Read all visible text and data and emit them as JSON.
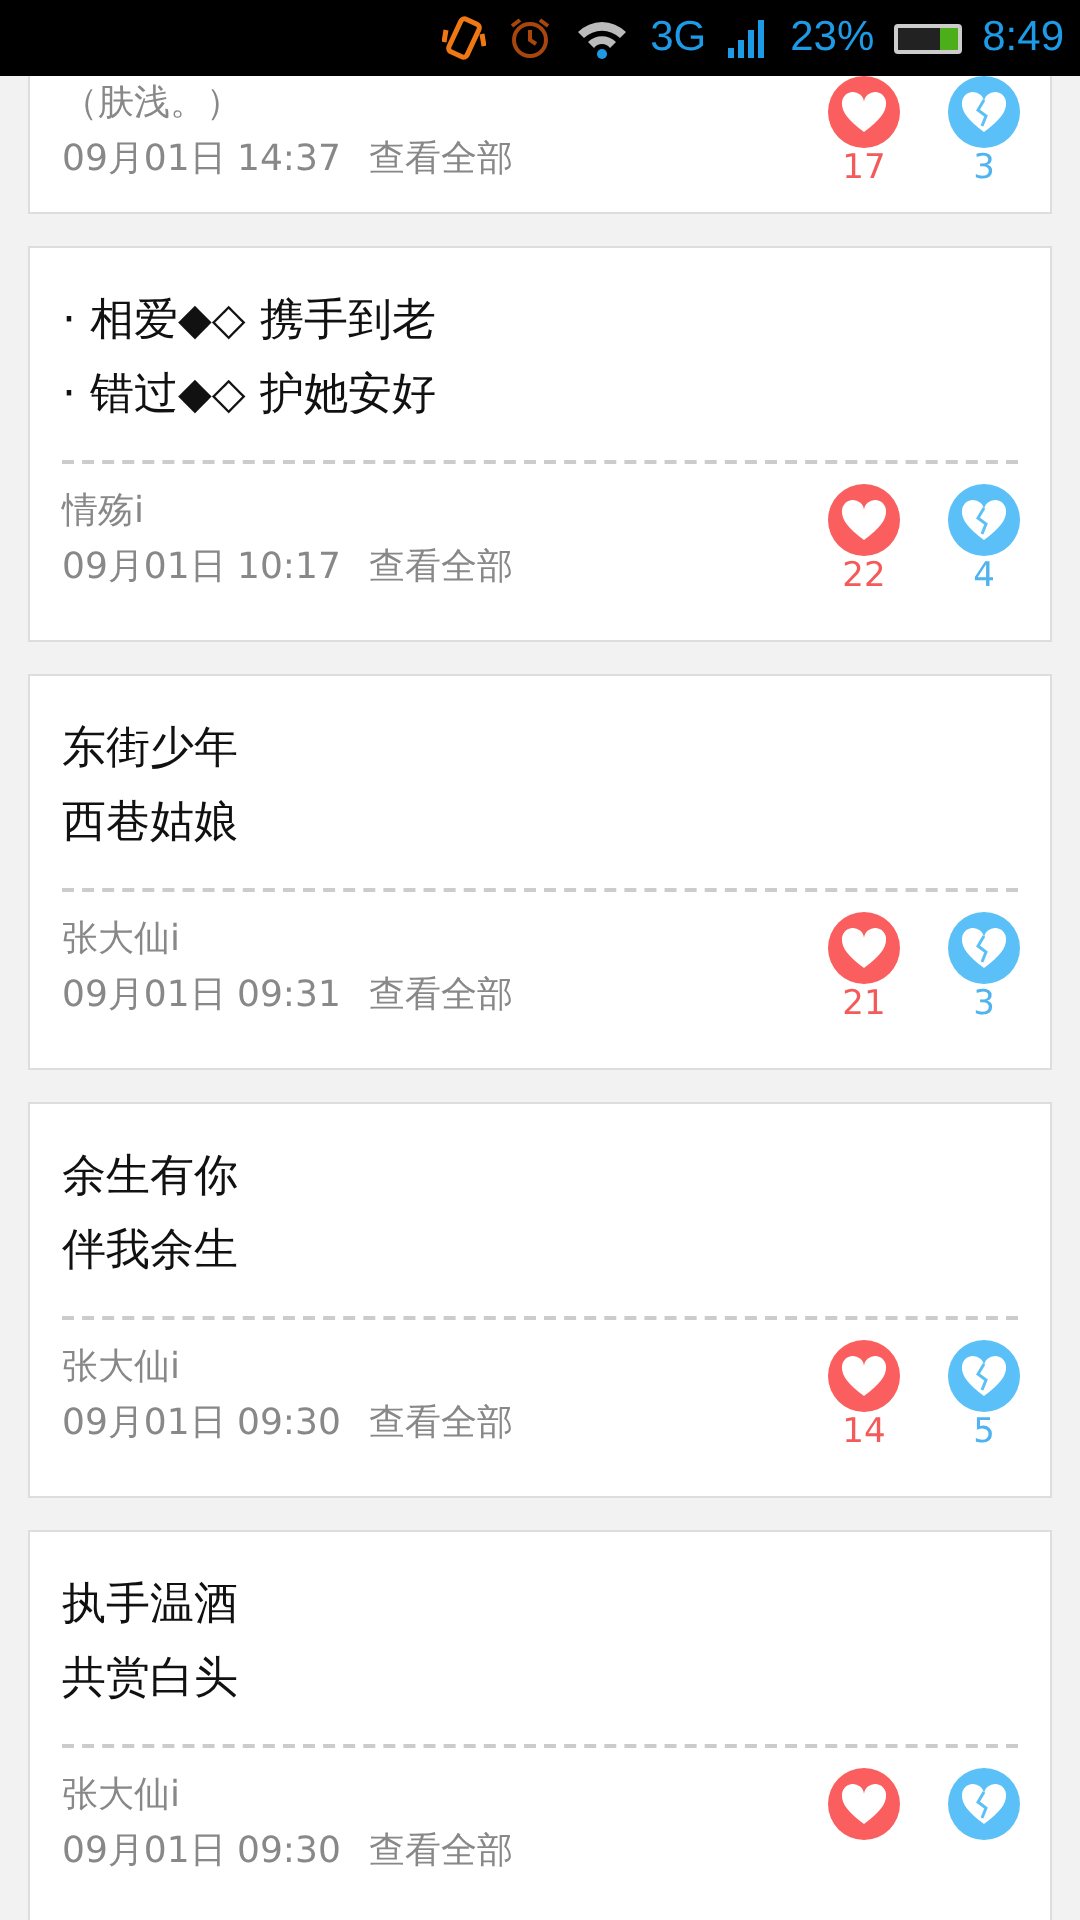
{
  "status_bar": {
    "network": "3G",
    "battery_text": "23%",
    "time": "8:49"
  },
  "posts": [
    {
      "author": "（肤浅。）",
      "date": "09月01日 14:37",
      "view_all": "查看全部",
      "likes": "17",
      "dislikes": "3"
    },
    {
      "lines": [
        "· 相爱◆◇ 携手到老",
        "· 错过◆◇ 护她安好"
      ],
      "author": "情殇i",
      "date": "09月01日 10:17",
      "view_all": "查看全部",
      "likes": "22",
      "dislikes": "4"
    },
    {
      "lines": [
        "东街少年",
        "西巷姑娘"
      ],
      "author": "张大仙i",
      "date": "09月01日 09:31",
      "view_all": "查看全部",
      "likes": "21",
      "dislikes": "3"
    },
    {
      "lines": [
        "余生有你",
        "伴我余生"
      ],
      "author": "张大仙i",
      "date": "09月01日 09:30",
      "view_all": "查看全部",
      "likes": "14",
      "dislikes": "5"
    },
    {
      "lines": [
        "执手温酒",
        "共赏白头"
      ],
      "author": "张大仙i",
      "date": "09月01日 09:30",
      "view_all": "查看全部"
    }
  ]
}
